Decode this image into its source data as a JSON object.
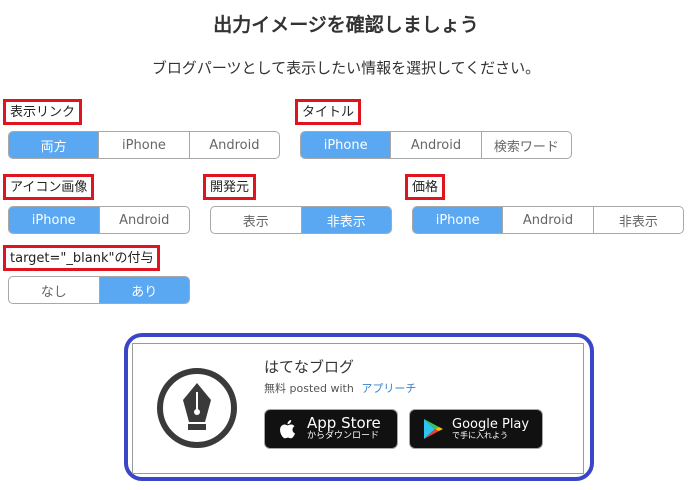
{
  "header": {
    "title": "出力イメージを確認しましょう",
    "subtitle": "ブログパーツとして表示したい情報を選択してください。"
  },
  "options": {
    "display_link": {
      "label": "表示リンク",
      "choices": [
        "両方",
        "iPhone",
        "Android"
      ],
      "selected": "両方"
    },
    "title": {
      "label": "タイトル",
      "choices": [
        "iPhone",
        "Android",
        "検索ワード"
      ],
      "selected": "iPhone"
    },
    "icon_image": {
      "label": "アイコン画像",
      "choices": [
        "iPhone",
        "Android"
      ],
      "selected": "iPhone"
    },
    "developer": {
      "label": "開発元",
      "choices": [
        "表示",
        "非表示"
      ],
      "selected": "非表示"
    },
    "price": {
      "label": "価格",
      "choices": [
        "iPhone",
        "Android",
        "非表示"
      ],
      "selected": "iPhone"
    },
    "target_blank": {
      "label": "target=\"_blank\"の付与",
      "choices": [
        "なし",
        "あり"
      ],
      "selected": "あり"
    }
  },
  "preview": {
    "app_name": "はてなブログ",
    "price": "無料",
    "posted_with": "posted with",
    "posted_link": "アプリーチ",
    "app_store": {
      "main": "App Store",
      "sub": "からダウンロード"
    },
    "google_play": {
      "main": "Google Play",
      "sub": "で手に入れよう"
    }
  },
  "colors": {
    "active": "#5aa7f2",
    "label_border": "#e0141e",
    "preview_frame": "#3a45c8",
    "link": "#3b83c9"
  },
  "icons": [
    "fountain-pen-icon",
    "apple-icon",
    "google-play-icon"
  ]
}
